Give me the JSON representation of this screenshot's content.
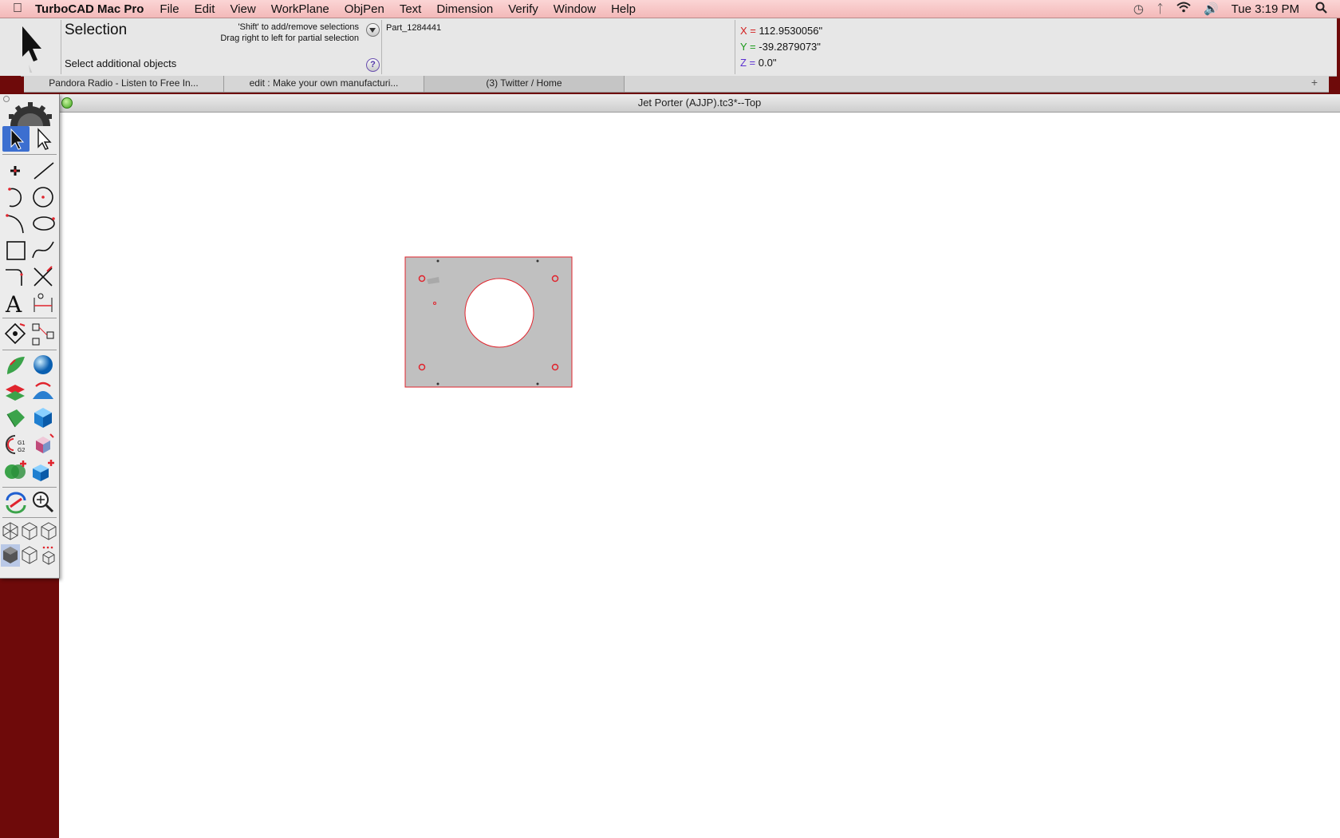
{
  "menubar": {
    "app_name": "TurboCAD Mac Pro",
    "items": [
      "File",
      "Edit",
      "View",
      "WorkPlane",
      "ObjPen",
      "Text",
      "Dimension",
      "Verify",
      "Window",
      "Help"
    ],
    "clock": "Tue 3:19 PM"
  },
  "inspector": {
    "tool_title": "Selection",
    "tool_prompt": "Select additional objects",
    "hint_shift": "'Shift' to add/remove selections",
    "hint_drag": "Drag right to left for partial selection",
    "part_name": "Part_1284441",
    "coords": {
      "x_label": "X =",
      "x_value": "112.9530056\"",
      "y_label": "Y =",
      "y_value": "-39.2879073\"",
      "z_label": "Z =",
      "z_value": "0.0\""
    }
  },
  "browser_tabs": [
    "Pandora Radio - Listen to Free In...",
    "edit : Make your own manufacturi...",
    "(3) Twitter / Home"
  ],
  "drawing_window": {
    "title": "Jet Porter (AJJP).tc3*--Top"
  },
  "colors": {
    "menubar": "#f3b9b9",
    "selection_red": "#e0242d",
    "part_fill": "#c0c0c0",
    "desktop": "#6e0a0a"
  }
}
